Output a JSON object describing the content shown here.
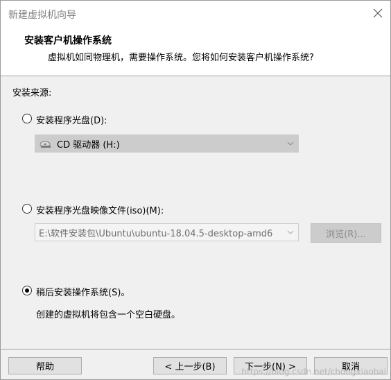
{
  "window": {
    "title": "新建虚拟机向导"
  },
  "header": {
    "title": "安装客户机操作系统",
    "subtitle": "虚拟机如同物理机，需要操作系统。您将如何安装客户机操作系统?"
  },
  "source": {
    "label": "安装来源:",
    "options": [
      {
        "label": "安装程序光盘(D):",
        "selected": false,
        "combo_value": "CD 驱动器 (H:)"
      },
      {
        "label": "安装程序光盘映像文件(iso)(M):",
        "selected": false,
        "combo_value": "E:\\软件安装包\\Ubuntu\\ubuntu-18.04.5-desktop-amd6",
        "browse_label": "浏览(R)..."
      },
      {
        "label": "稍后安装操作系统(S)。",
        "selected": true,
        "description": "创建的虚拟机将包含一个空白硬盘。"
      }
    ]
  },
  "footer": {
    "help_label": "帮助",
    "back_label": "< 上一步(B)",
    "next_label": "下一步(N) >",
    "cancel_label": "取消"
  },
  "watermark": "https://blog.csdn.net/chongxiaobai"
}
